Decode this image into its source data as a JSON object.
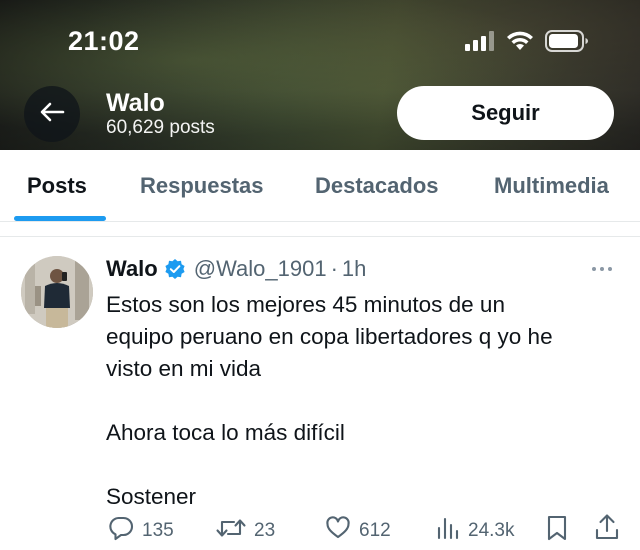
{
  "status_bar": {
    "time": "21:02"
  },
  "header": {
    "name": "Walo",
    "posts_count": "60,629 posts",
    "follow_label": "Seguir"
  },
  "tabs": [
    {
      "label": "Posts",
      "active": true
    },
    {
      "label": "Respuestas",
      "active": false
    },
    {
      "label": "Destacados",
      "active": false
    },
    {
      "label": "Multimedia",
      "active": false
    }
  ],
  "tweet": {
    "author_name": "Walo",
    "handle": "@Walo_1901",
    "separator": "·",
    "time": "1h",
    "text_lines": [
      "Estos son los mejores 45 minutos de un",
      "equipo peruano en copa libertadores q yo he",
      "visto en mi vida",
      "Ahora toca lo más difícil",
      "Sostener"
    ],
    "metrics": {
      "replies": "135",
      "reposts": "23",
      "likes": "612",
      "views": "24.3k"
    }
  },
  "colors": {
    "accent": "#1d9bf0",
    "text_primary": "#0f1419",
    "text_secondary": "#536471"
  },
  "icons": [
    "back-arrow-icon",
    "signal-icon",
    "wifi-icon",
    "battery-icon",
    "verified-badge-icon",
    "more-icon",
    "reply-icon",
    "repost-icon",
    "like-icon",
    "views-icon",
    "bookmark-icon",
    "share-icon"
  ]
}
